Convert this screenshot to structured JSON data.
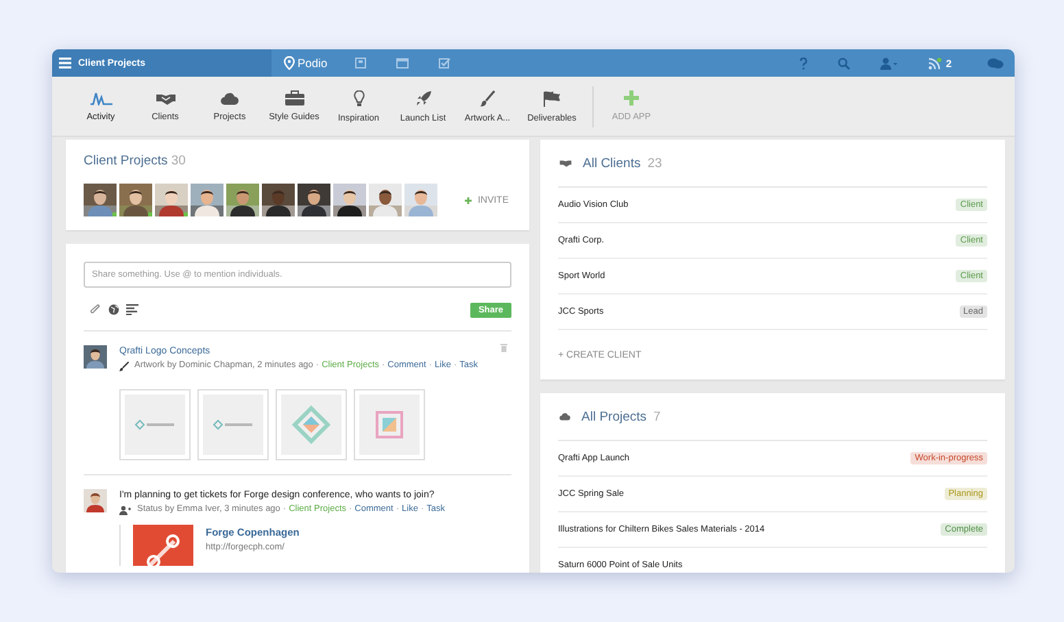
{
  "topbar": {
    "workspace": "Client Projects",
    "app_name": "Podio",
    "notification_count": "2"
  },
  "apps": [
    {
      "label": "Activity",
      "kind": "activity",
      "selected": true
    },
    {
      "label": "Clients",
      "kind": "clients",
      "selected": false
    },
    {
      "label": "Projects",
      "kind": "projects",
      "selected": false
    },
    {
      "label": "Style Guides",
      "kind": "briefcase",
      "selected": false
    },
    {
      "label": "Inspiration",
      "kind": "bulb",
      "selected": false
    },
    {
      "label": "Launch List",
      "kind": "rocket",
      "selected": false
    },
    {
      "label": "Artwork A...",
      "kind": "brush",
      "selected": false
    },
    {
      "label": "Deliverables",
      "kind": "flags",
      "selected": false
    },
    {
      "label": "ADD APP",
      "kind": "add",
      "selected": false
    }
  ],
  "members_card": {
    "title": "Client Projects",
    "count": "30",
    "invite": "INVITE",
    "members": [
      {
        "online": true
      },
      {
        "online": true
      },
      {
        "online": true
      },
      {
        "online": false
      },
      {
        "online": false
      },
      {
        "online": false
      },
      {
        "online": false
      },
      {
        "online": false
      },
      {
        "online": false
      },
      {
        "online": false
      }
    ]
  },
  "stream": {
    "share_placeholder": "Share something. Use @ to mention individuals.",
    "share_button": "Share",
    "posts": [
      {
        "kind": "files",
        "title": "Qrafti Logo Concepts",
        "meta": [
          {
            "kind": "text",
            "text": "Artwork by Dominic Chapman, 2 minutes ago"
          },
          {
            "kind": "sep",
            "text": "·"
          },
          {
            "kind": "space",
            "text": "Client Projects"
          },
          {
            "kind": "sep",
            "text": "·"
          },
          {
            "kind": "action",
            "text": "Comment"
          },
          {
            "kind": "sep",
            "text": "·"
          },
          {
            "kind": "action",
            "text": "Like"
          },
          {
            "kind": "sep",
            "text": "·"
          },
          {
            "kind": "action",
            "text": "Task"
          }
        ],
        "attachments": [
          {
            "kind": "picture"
          },
          {
            "kind": "picture"
          },
          {
            "kind": "picture"
          },
          {
            "kind": "picture"
          }
        ]
      },
      {
        "kind": "status",
        "title": "I'm planning to get tickets for Forge design conference, who wants to join?",
        "meta": [
          {
            "kind": "text",
            "text": "Status by Emma Iver, 3 minutes ago"
          },
          {
            "kind": "sep",
            "text": "·"
          },
          {
            "kind": "space",
            "text": "Client Projects"
          },
          {
            "kind": "sep",
            "text": "·"
          },
          {
            "kind": "action",
            "text": "Comment"
          },
          {
            "kind": "sep",
            "text": "·"
          },
          {
            "kind": "action",
            "text": "Like"
          },
          {
            "kind": "sep",
            "text": "·"
          },
          {
            "kind": "action",
            "text": "Task"
          }
        ],
        "link": {
          "title": "Forge Copenhagen",
          "url": "http://forgecph.com/"
        }
      }
    ]
  },
  "clients": {
    "title": "All Clients",
    "count": "23",
    "create": "+ CREATE CLIENT",
    "rows": [
      {
        "name": "Audio Vision Club",
        "tag": "Client",
        "color": "#5b9a4b"
      },
      {
        "name": "Qrafti Corp.",
        "tag": "Client",
        "color": "#5b9a4b"
      },
      {
        "name": "Sport World",
        "tag": "Client",
        "color": "#5b9a4b"
      },
      {
        "name": "JCC Sports",
        "tag": "Lead",
        "color": "#666666"
      }
    ]
  },
  "projects": {
    "title": "All Projects",
    "count": "7",
    "rows": [
      {
        "name": "Qrafti App Launch",
        "tag": "Work-in-progress",
        "color": "#c8492c"
      },
      {
        "name": "JCC Spring Sale",
        "tag": "Planning",
        "color": "#a8981c"
      },
      {
        "name": "Illustrations for Chiltern Bikes Sales Materials - 2014",
        "tag": "Complete",
        "color": "#4f8f45"
      },
      {
        "name": "Saturn 6000 Point of Sale Units"
      }
    ]
  }
}
